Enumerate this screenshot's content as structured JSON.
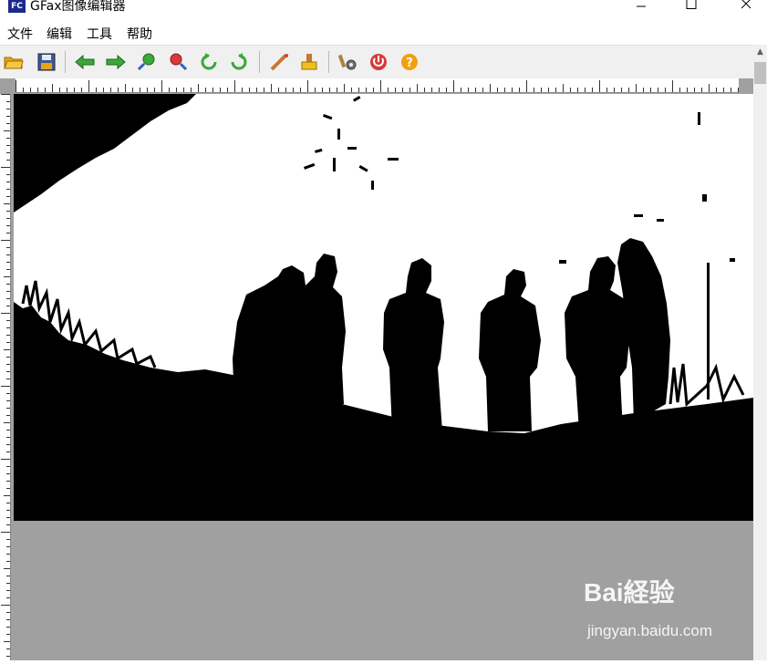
{
  "window": {
    "title": "GFax图像编辑器",
    "icon_label": "FC",
    "controls": [
      "minimize-icon",
      "maximize-icon",
      "close-icon"
    ]
  },
  "menu": [
    "文件",
    "编辑",
    "工具",
    "帮助"
  ],
  "toolbar": [
    {
      "icon": "open-folder-icon"
    },
    {
      "icon": "save-icon"
    },
    {
      "icon": "arrow-left-icon"
    },
    {
      "icon": "arrow-right-icon"
    },
    {
      "icon": "zoom-in-icon"
    },
    {
      "icon": "zoom-out-icon"
    },
    {
      "icon": "rotate-left-icon"
    },
    {
      "icon": "rotate-right-icon"
    },
    {
      "icon": "pen-icon"
    },
    {
      "icon": "eraser-icon"
    },
    {
      "icon": "settings-icon"
    },
    {
      "icon": "power-icon"
    },
    {
      "icon": "help-icon"
    }
  ],
  "canvas": {
    "image": "black-and-white silhouette of five people standing outdoors"
  },
  "watermark": {
    "logo": "Bai経验",
    "url": "jingyan.baidu.com"
  },
  "colors": {
    "workspace": "#a0a0a0",
    "toolbar": "#f0f0f0",
    "icon_folder": "#e8a317",
    "icon_arrow": "#3aa83a",
    "icon_power": "#d83a3a",
    "icon_help": "#f0a010"
  }
}
